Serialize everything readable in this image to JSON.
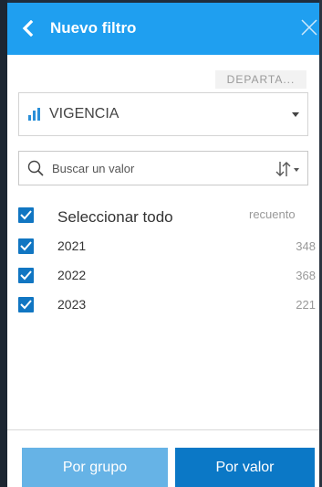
{
  "header": {
    "title": "Nuevo filtro"
  },
  "field_tag": "DEPARTA...",
  "field_select": {
    "value": "VIGENCIA"
  },
  "search": {
    "placeholder": "Buscar un valor"
  },
  "list": {
    "select_all_label": "Seleccionar todo",
    "count_header": "recuento",
    "items": [
      {
        "label": "2021",
        "count": "348",
        "checked": true
      },
      {
        "label": "2022",
        "count": "368",
        "checked": true
      },
      {
        "label": "2023",
        "count": "221",
        "checked": true
      }
    ]
  },
  "footer": {
    "by_group_label": "Por grupo",
    "by_value_label": "Por valor"
  },
  "colors": {
    "header_bg": "#1f9ff0",
    "checkbox": "#1176c2",
    "button_primary": "#0b78c6",
    "button_secondary": "#66b3e6"
  }
}
